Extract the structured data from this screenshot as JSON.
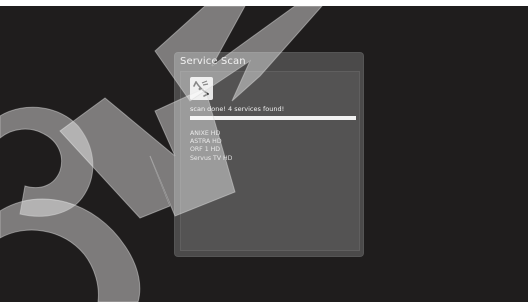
{
  "dialog": {
    "title": "Service Scan",
    "icon": "satellite-dish-icon",
    "status": "scan done! 4 services found!",
    "progress": 1.0,
    "services": [
      "ANIXE HD",
      "ASTRA HD",
      "ORF 1 HD",
      "Servus TV HD"
    ]
  },
  "colors": {
    "screen_background": "#1f1d1d",
    "dialog_background": "#4b4a4a",
    "progress_fill": "#f2f2f2"
  }
}
